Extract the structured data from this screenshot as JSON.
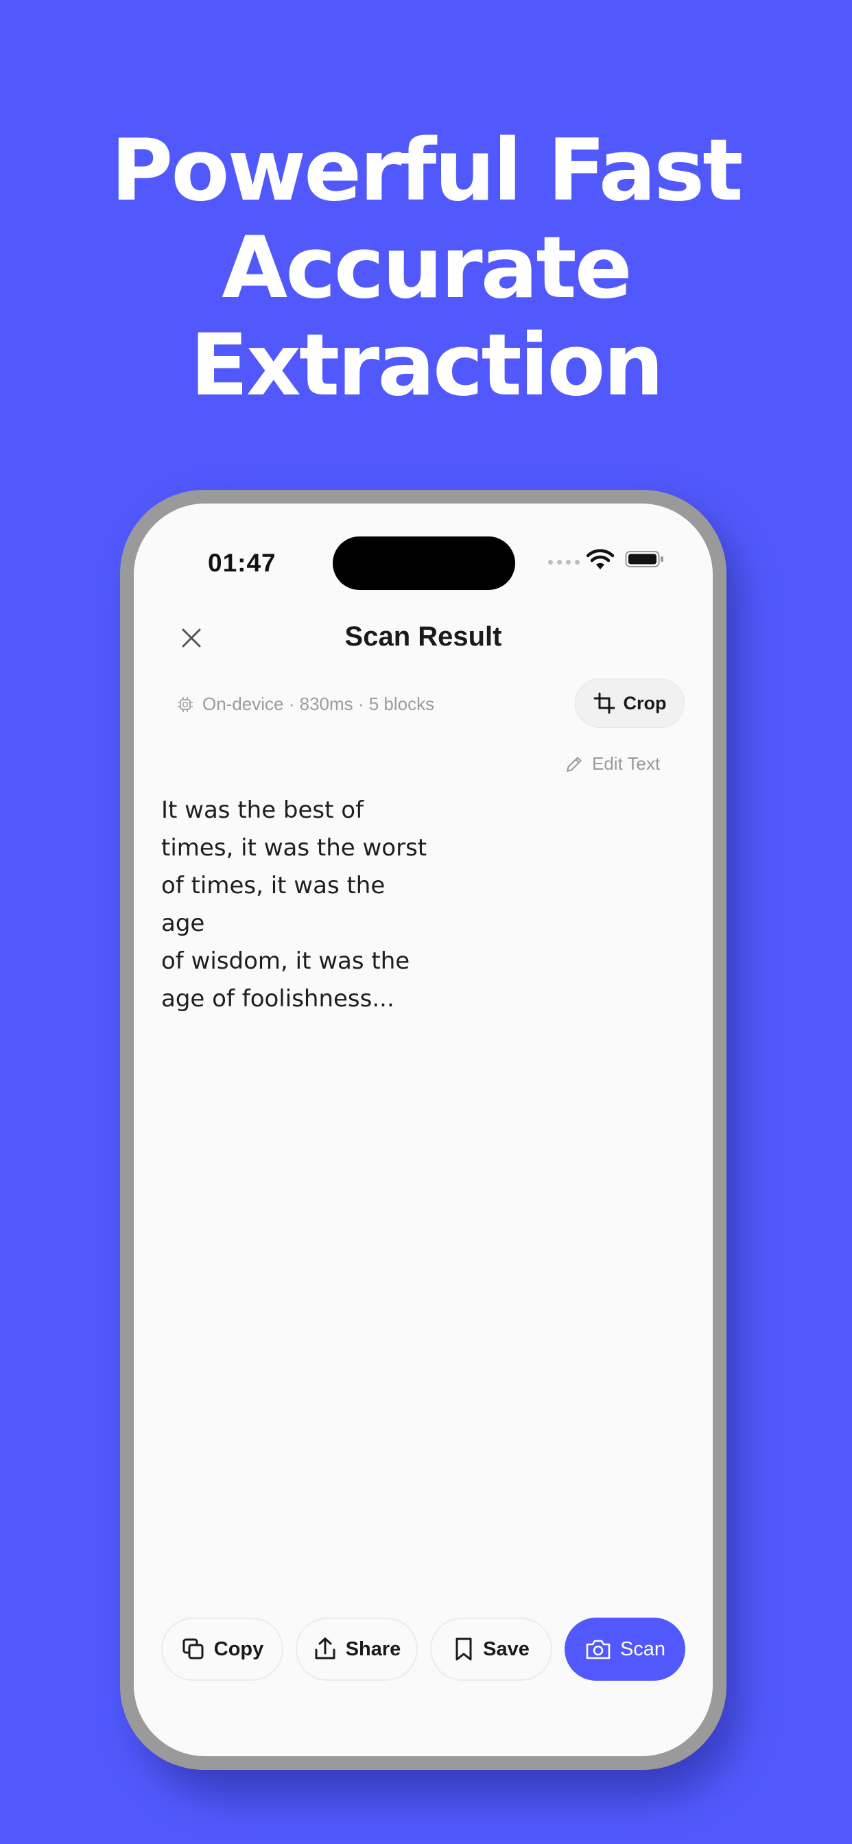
{
  "headline": {
    "line1": "Powerful Fast",
    "line2": "Accurate",
    "line3": "Extraction"
  },
  "status_bar": {
    "time": "01:47"
  },
  "nav": {
    "title": "Scan Result"
  },
  "meta": {
    "info": "On-device · 830ms · 5 blocks",
    "crop_label": "Crop",
    "edit_label": "Edit Text"
  },
  "content": {
    "lines": [
      "It was the best of",
      "times, it was the worst",
      "of times, it was the age",
      "of wisdom, it was the",
      "age of foolishness..."
    ]
  },
  "actions": {
    "copy": "Copy",
    "share": "Share",
    "save": "Save",
    "scan": "Scan"
  },
  "colors": {
    "background": "#5159FC",
    "accent": "#5159FC",
    "screen": "#FAFAFA"
  },
  "icons": [
    "close-icon",
    "chip-icon",
    "crop-icon",
    "pencil-icon",
    "copy-icon",
    "share-icon",
    "bookmark-icon",
    "camera-icon",
    "wifi-icon",
    "battery-icon"
  ]
}
